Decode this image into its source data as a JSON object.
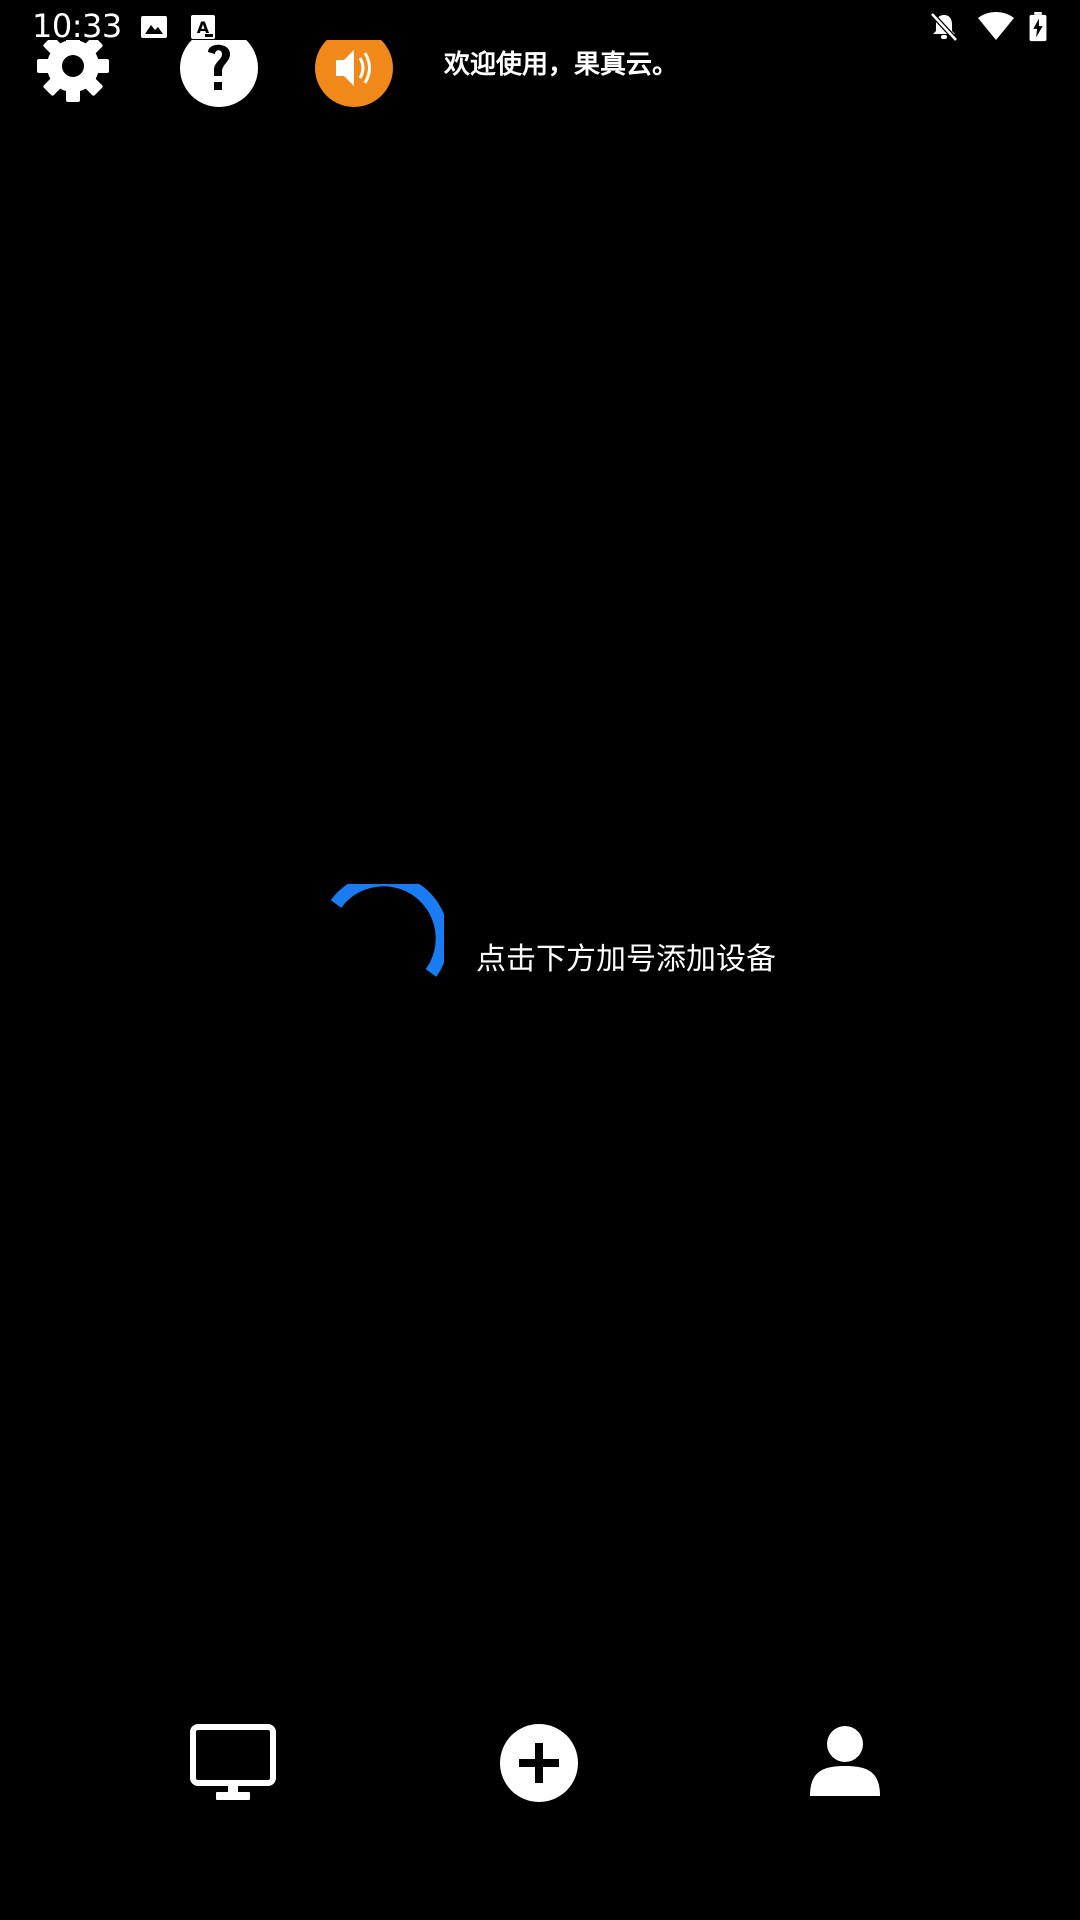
{
  "status_bar": {
    "time": "10:33",
    "icons": [
      "image-icon",
      "font-icon",
      "notifications-off-icon",
      "wifi-icon",
      "battery-charging-icon"
    ]
  },
  "top_bar": {
    "buttons": [
      "settings-gear-icon",
      "help-icon",
      "announcement-speaker-icon"
    ],
    "welcome_text": "欢迎使用，果真云。",
    "speaker_color": "#F0891A"
  },
  "main": {
    "empty_hint": "点击下方加号添加设备",
    "spinner_color": "#1A7CF2"
  },
  "bottom_nav": {
    "items": [
      "devices-monitor-icon",
      "add-device-icon",
      "user-profile-icon"
    ]
  }
}
